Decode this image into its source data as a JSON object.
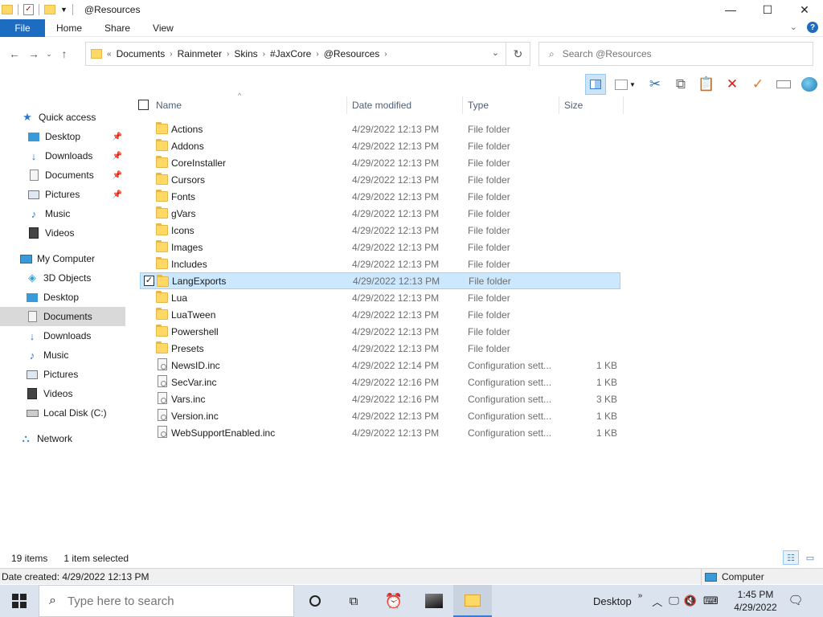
{
  "window": {
    "title": "@Resources",
    "minimize": "—",
    "maximize": "☐",
    "close": "✕"
  },
  "ribbon": {
    "file": "File",
    "tabs": [
      "Home",
      "Share",
      "View"
    ]
  },
  "address": {
    "prefix": "«",
    "crumbs": [
      "Documents",
      "Rainmeter",
      "Skins",
      "#JaxCore",
      "@Resources"
    ]
  },
  "search": {
    "placeholder": "Search @Resources"
  },
  "sidebar": {
    "quick_access": "Quick access",
    "quick_items": [
      {
        "label": "Desktop",
        "icon": "desktop-icon",
        "pinned": true
      },
      {
        "label": "Downloads",
        "icon": "download-icon",
        "pinned": true
      },
      {
        "label": "Documents",
        "icon": "document-icon",
        "pinned": true
      },
      {
        "label": "Pictures",
        "icon": "pictures-icon",
        "pinned": true
      },
      {
        "label": "Music",
        "icon": "music-icon",
        "pinned": false
      },
      {
        "label": "Videos",
        "icon": "videos-icon",
        "pinned": false
      }
    ],
    "computer": "My Computer",
    "computer_items": [
      {
        "label": "3D Objects",
        "icon": "3d-objects-icon"
      },
      {
        "label": "Desktop",
        "icon": "desktop-icon"
      },
      {
        "label": "Documents",
        "icon": "document-icon",
        "selected": true
      },
      {
        "label": "Downloads",
        "icon": "download-icon"
      },
      {
        "label": "Music",
        "icon": "music-icon"
      },
      {
        "label": "Pictures",
        "icon": "pictures-icon"
      },
      {
        "label": "Videos",
        "icon": "videos-icon"
      },
      {
        "label": "Local Disk (C:)",
        "icon": "disk-icon"
      }
    ],
    "network": "Network"
  },
  "columns": {
    "name": "Name",
    "date": "Date modified",
    "type": "Type",
    "size": "Size"
  },
  "files": [
    {
      "name": "Actions",
      "date": "4/29/2022 12:13 PM",
      "type": "File folder",
      "size": "",
      "kind": "folder"
    },
    {
      "name": "Addons",
      "date": "4/29/2022 12:13 PM",
      "type": "File folder",
      "size": "",
      "kind": "folder"
    },
    {
      "name": "CoreInstaller",
      "date": "4/29/2022 12:13 PM",
      "type": "File folder",
      "size": "",
      "kind": "folder"
    },
    {
      "name": "Cursors",
      "date": "4/29/2022 12:13 PM",
      "type": "File folder",
      "size": "",
      "kind": "folder"
    },
    {
      "name": "Fonts",
      "date": "4/29/2022 12:13 PM",
      "type": "File folder",
      "size": "",
      "kind": "folder"
    },
    {
      "name": "gVars",
      "date": "4/29/2022 12:13 PM",
      "type": "File folder",
      "size": "",
      "kind": "folder"
    },
    {
      "name": "Icons",
      "date": "4/29/2022 12:13 PM",
      "type": "File folder",
      "size": "",
      "kind": "folder"
    },
    {
      "name": "Images",
      "date": "4/29/2022 12:13 PM",
      "type": "File folder",
      "size": "",
      "kind": "folder"
    },
    {
      "name": "Includes",
      "date": "4/29/2022 12:13 PM",
      "type": "File folder",
      "size": "",
      "kind": "folder"
    },
    {
      "name": "LangExports",
      "date": "4/29/2022 12:13 PM",
      "type": "File folder",
      "size": "",
      "kind": "folder",
      "selected": true
    },
    {
      "name": "Lua",
      "date": "4/29/2022 12:13 PM",
      "type": "File folder",
      "size": "",
      "kind": "folder"
    },
    {
      "name": "LuaTween",
      "date": "4/29/2022 12:13 PM",
      "type": "File folder",
      "size": "",
      "kind": "folder"
    },
    {
      "name": "Powershell",
      "date": "4/29/2022 12:13 PM",
      "type": "File folder",
      "size": "",
      "kind": "folder"
    },
    {
      "name": "Presets",
      "date": "4/29/2022 12:13 PM",
      "type": "File folder",
      "size": "",
      "kind": "folder"
    },
    {
      "name": "NewsID.inc",
      "date": "4/29/2022 12:14 PM",
      "type": "Configuration sett...",
      "size": "1 KB",
      "kind": "file"
    },
    {
      "name": "SecVar.inc",
      "date": "4/29/2022 12:16 PM",
      "type": "Configuration sett...",
      "size": "1 KB",
      "kind": "file"
    },
    {
      "name": "Vars.inc",
      "date": "4/29/2022 12:16 PM",
      "type": "Configuration sett...",
      "size": "3 KB",
      "kind": "file"
    },
    {
      "name": "Version.inc",
      "date": "4/29/2022 12:13 PM",
      "type": "Configuration sett...",
      "size": "1 KB",
      "kind": "file"
    },
    {
      "name": "WebSupportEnabled.inc",
      "date": "4/29/2022 12:13 PM",
      "type": "Configuration sett...",
      "size": "1 KB",
      "kind": "file"
    }
  ],
  "status": {
    "count": "19 items",
    "selected": "1 item selected"
  },
  "details": {
    "created": "Date created: 4/29/2022 12:13 PM",
    "location": "Computer"
  },
  "taskbar": {
    "search_placeholder": "Type here to search",
    "desktop_label": "Desktop",
    "time": "1:45 PM",
    "date": "4/29/2022"
  },
  "colors": {
    "accent": "#1c6cc2",
    "selection": "#cce8ff",
    "folder": "#ffd866"
  }
}
